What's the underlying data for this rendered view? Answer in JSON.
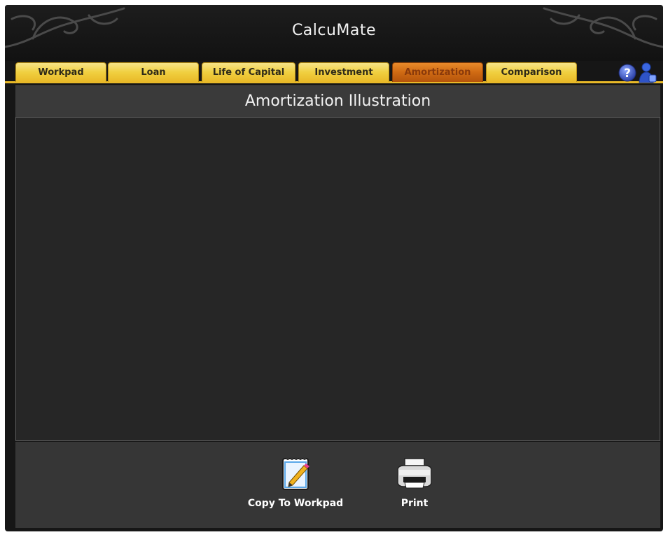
{
  "app": {
    "title": "CalcuMate"
  },
  "tabs": [
    {
      "label": "Workpad",
      "active": false
    },
    {
      "label": "Loan",
      "active": false
    },
    {
      "label": "Life of Capital",
      "active": false
    },
    {
      "label": "Investment",
      "active": false
    },
    {
      "label": "Amortization",
      "active": true
    },
    {
      "label": "Comparison",
      "active": false
    }
  ],
  "header_icons": [
    "help-icon",
    "user-icon"
  ],
  "main": {
    "heading": "Amortization Illustration"
  },
  "footer": {
    "actions": [
      {
        "label": "Copy To Workpad",
        "icon": "notepad-pencil-icon"
      },
      {
        "label": "Print",
        "icon": "printer-icon"
      }
    ]
  },
  "colors": {
    "tab_yellow": "#f0cf3f",
    "tab_active_orange": "#cf6a13",
    "background": "#161616",
    "panel": "#262626"
  }
}
